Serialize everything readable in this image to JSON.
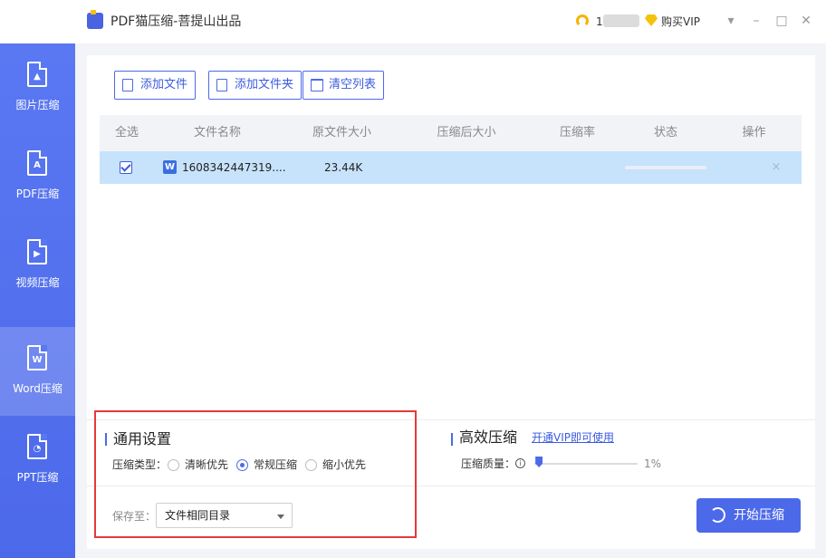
{
  "app": {
    "title": "PDF猫压缩-菩提山出品"
  },
  "user": {
    "name": "1",
    "vip_label": "购买VIP"
  },
  "window": {
    "minimize": "▾",
    "restore": "–",
    "maximize": "□",
    "close": "✕"
  },
  "sidebar": {
    "items": [
      {
        "label": "图片压缩",
        "icon": "image-file-icon",
        "glyph": "▲",
        "active": false
      },
      {
        "label": "PDF压缩",
        "icon": "pdf-file-icon",
        "glyph": "A",
        "active": false
      },
      {
        "label": "视频压缩",
        "icon": "video-file-icon",
        "glyph": "▶",
        "active": false
      },
      {
        "label": "Word压缩",
        "icon": "word-file-icon",
        "glyph": "W",
        "active": true
      },
      {
        "label": "PPT压缩",
        "icon": "ppt-file-icon",
        "glyph": "◔",
        "active": false
      }
    ]
  },
  "toolbar": {
    "add_file": "添加文件",
    "add_folder": "添加文件夹",
    "clear_list": "清空列表"
  },
  "table": {
    "headers": [
      "全选",
      "文件名称",
      "原文件大小",
      "压缩后大小",
      "压缩率",
      "状态",
      "操作"
    ],
    "rows": [
      {
        "checked": true,
        "icon": "W",
        "name": "1608342447319....",
        "original_size": "23.44K",
        "compressed_size": "",
        "ratio": "",
        "progress": 0,
        "delete": "×"
      }
    ]
  },
  "settings": {
    "general_title": "通用设置",
    "type_label": "压缩类型：",
    "options": [
      {
        "label": "清晰优先",
        "selected": false
      },
      {
        "label": "常规压缩",
        "selected": true
      },
      {
        "label": "缩小优先",
        "selected": false
      }
    ],
    "save_label": "保存至：",
    "save_value": "文件相同目录"
  },
  "efficient": {
    "title": "高效压缩",
    "vip_link": "开通VIP即可使用",
    "quality_label": "压缩质量：",
    "info": "i",
    "quality_value": "1%",
    "quality_level": 0.01
  },
  "actions": {
    "start": "开始压缩"
  },
  "colors": {
    "accent": "#4c69ea",
    "highlight": "#e53a3a",
    "row_selected": "#c7e3fb"
  }
}
